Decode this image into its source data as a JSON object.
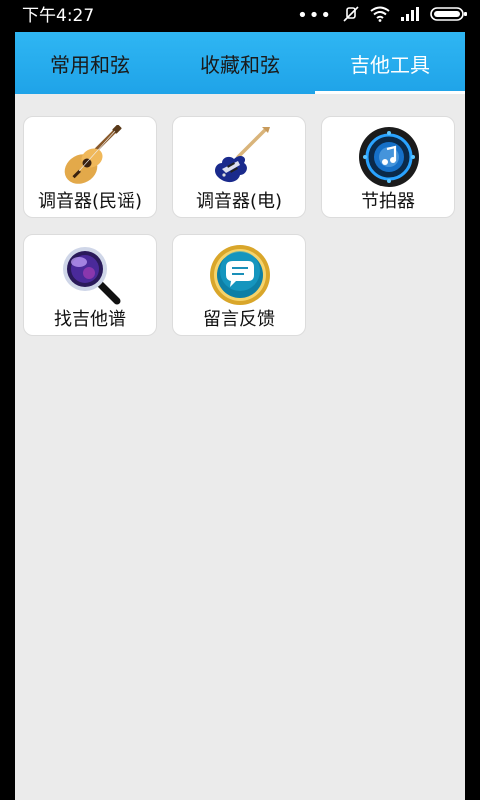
{
  "status_bar": {
    "time": "下午4:27",
    "icons": [
      "more-dots-icon",
      "muted-icon",
      "wifi-icon",
      "signal-icon",
      "battery-icon"
    ]
  },
  "tabs": [
    {
      "label": "常用和弦",
      "active": false
    },
    {
      "label": "收藏和弦",
      "active": false
    },
    {
      "label": "吉他工具",
      "active": true
    }
  ],
  "tools": [
    {
      "label": "调音器(民谣)",
      "icon": "acoustic-guitar-icon"
    },
    {
      "label": "调音器(电)",
      "icon": "electric-guitar-icon"
    },
    {
      "label": "节拍器",
      "icon": "metronome-speaker-icon"
    },
    {
      "label": "找吉他谱",
      "icon": "magnifier-icon"
    },
    {
      "label": "留言反馈",
      "icon": "feedback-bubble-icon"
    }
  ],
  "colors": {
    "tabbar": "#1fa3e8",
    "tab_active_text": "#ffffff",
    "tab_inactive_text": "#1a1a1a",
    "background": "#ebebeb"
  }
}
